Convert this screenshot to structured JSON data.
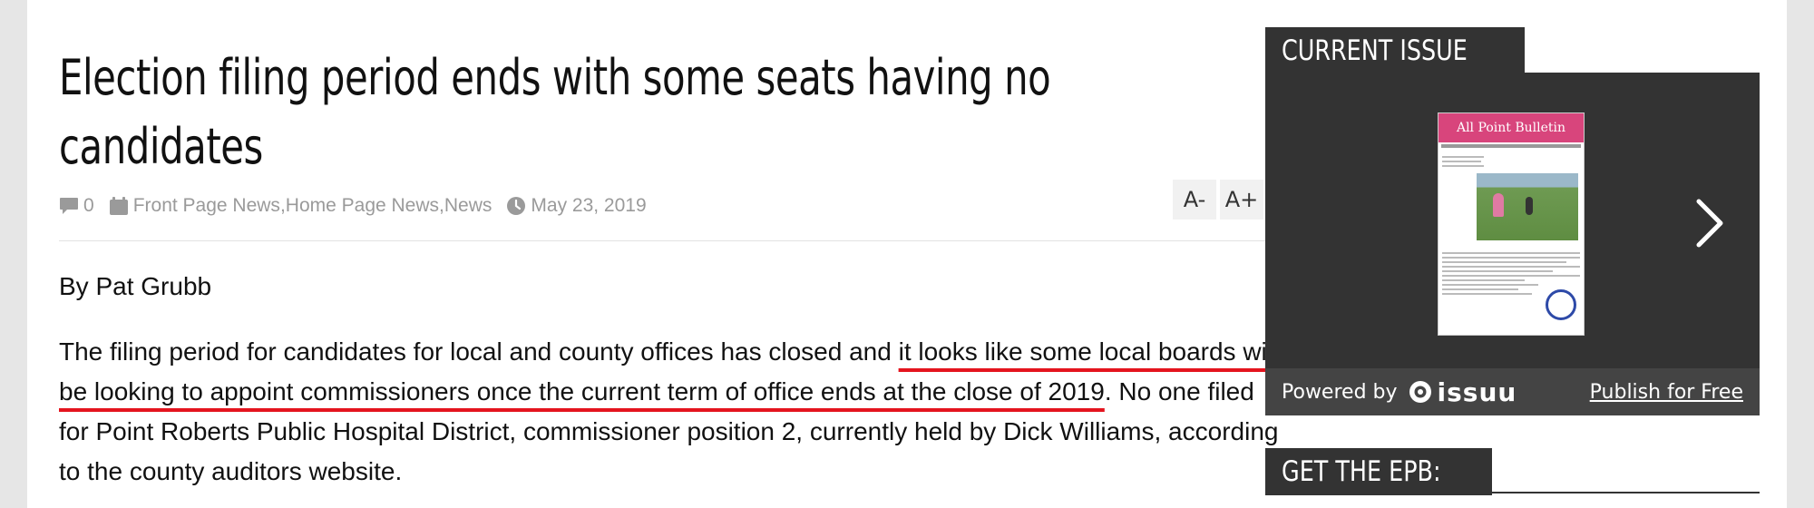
{
  "article": {
    "title": "Election filing period ends with some seats having no candidates",
    "meta": {
      "comment_count": "0",
      "categories": [
        "Front Page News",
        "Home Page News",
        "News"
      ],
      "category_separator": ", ",
      "date": "May 23, 2019"
    },
    "font_controls": {
      "decrease": "A-",
      "increase": "A+"
    },
    "byline": "By Pat Grubb",
    "body": {
      "p1_before": "The filing period for candidates for local and county offices has closed and ",
      "p1_highlight": "it looks like some local boards will be looking to appoint commissioners once the current term of office ends at the close of 2019",
      "p1_after": ". No one filed for Point Roberts Public Hospital District, commissioner position 2, currently held by Dick Williams, according to the county auditors website."
    },
    "highlight_color": "#e4141e"
  },
  "sidebar": {
    "current_issue": {
      "heading": "CURRENT ISSUE",
      "cover": {
        "masthead": "All Point Bulletin",
        "headline": "Cleaning up after the Easter Bunny"
      },
      "powered_by": "Powered by",
      "issuu_brand": "issuu",
      "publish_link": "Publish for Free"
    },
    "get_epb": {
      "heading": "GET THE EPB:"
    }
  },
  "icons": {
    "comment": "comment-icon",
    "category": "folder-icon",
    "date": "clock-icon",
    "next": "chevron-right-icon",
    "issuu": "issuu-logo-icon"
  },
  "colors": {
    "sidebar_dark": "#333333",
    "meta_gray": "#9a9a9a",
    "masthead_pink": "#d8457c"
  }
}
